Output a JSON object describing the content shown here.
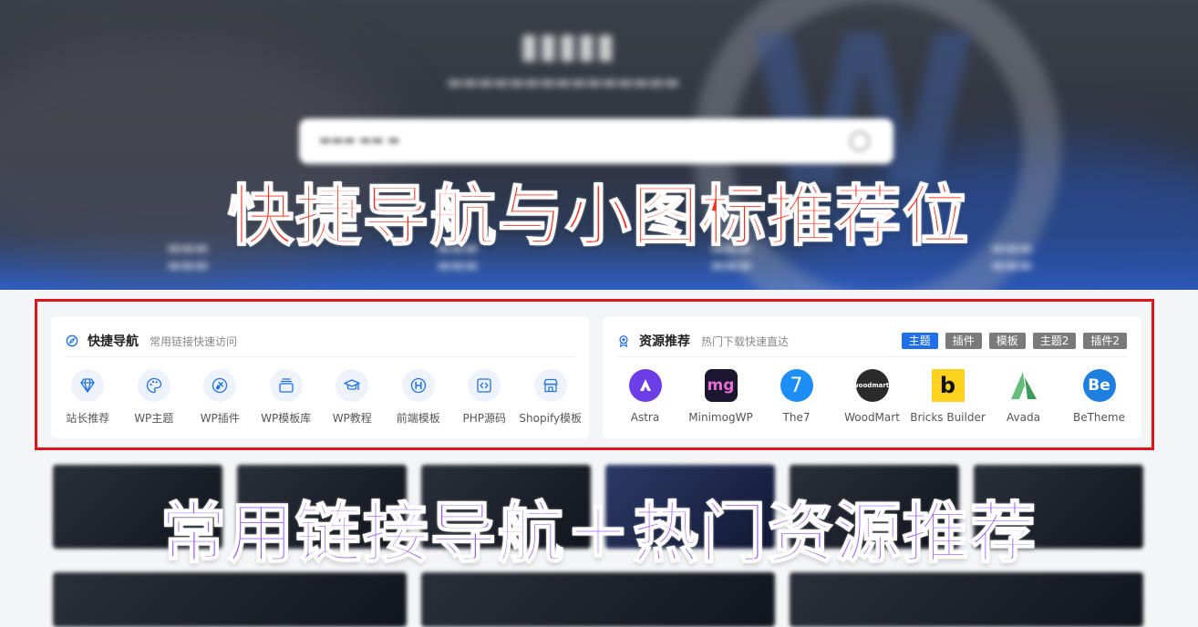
{
  "overlay": {
    "top_title": "快捷导航与小图标推荐位",
    "bottom_title": "常用链接导航＋热门资源推荐"
  },
  "quick_nav": {
    "title": "快捷导航",
    "subtitle": "常用链接快速访问",
    "icon": "compass-icon",
    "items": [
      {
        "label": "站长推荐",
        "icon": "diamond-icon"
      },
      {
        "label": "WP主题",
        "icon": "palette-icon"
      },
      {
        "label": "WP插件",
        "icon": "plug-icon"
      },
      {
        "label": "WP模板库",
        "icon": "layers-icon"
      },
      {
        "label": "WP教程",
        "icon": "graduation-cap-icon"
      },
      {
        "label": "前端模板",
        "icon": "h-letter-icon"
      },
      {
        "label": "PHP源码",
        "icon": "code-icon"
      },
      {
        "label": "Shopify模板",
        "icon": "store-icon"
      }
    ]
  },
  "resources": {
    "title": "资源推荐",
    "subtitle": "热门下载快速直达",
    "icon": "medal-icon",
    "tabs": [
      {
        "label": "主题",
        "active": true
      },
      {
        "label": "插件",
        "active": false
      },
      {
        "label": "模板",
        "active": false
      },
      {
        "label": "主题2",
        "active": false
      },
      {
        "label": "插件2",
        "active": false
      }
    ],
    "items": [
      {
        "label": "Astra",
        "logo_text": "A",
        "color": "#6d3de6"
      },
      {
        "label": "MinimogWP",
        "logo_text": "mg",
        "color": "#1c1630"
      },
      {
        "label": "The7",
        "logo_text": "7",
        "color": "#1e8ef7"
      },
      {
        "label": "WoodMart",
        "logo_text": "woodmart.",
        "color": "#2b2b2b"
      },
      {
        "label": "Bricks Builder",
        "logo_text": "b",
        "color": "#ffd21f"
      },
      {
        "label": "Avada",
        "logo_text": "A",
        "color": "#65bc7b"
      },
      {
        "label": "BeTheme",
        "logo_text": "Be",
        "color": "#1e7fe0"
      }
    ]
  },
  "colors": {
    "accent": "#1f6feb",
    "frame": "#e0141c",
    "top_title": "#ff2a1a",
    "bottom_title": "#9b5cf5"
  }
}
